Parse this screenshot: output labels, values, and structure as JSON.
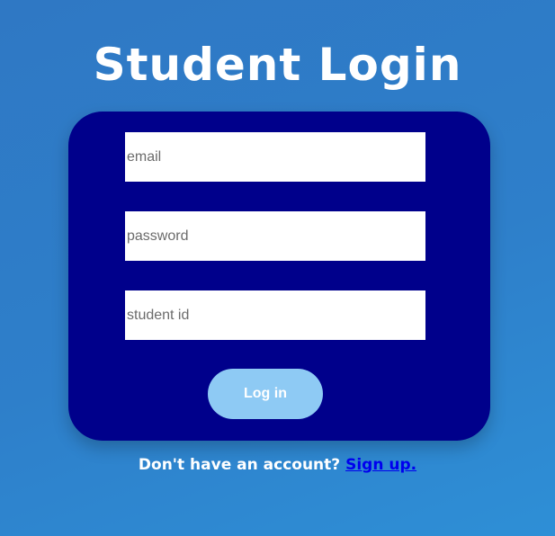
{
  "page": {
    "title": "Student Login"
  },
  "form": {
    "email_placeholder": "email",
    "email_value": "",
    "password_placeholder": "password",
    "password_value": "",
    "student_id_placeholder": "student id",
    "student_id_value": "",
    "login_label": "Log in"
  },
  "footer": {
    "prompt": "Don't have an account?",
    "signup_label": "Sign up."
  },
  "colors": {
    "background": "#2f7fca",
    "card": "#00008b",
    "button": "#8ecaf4",
    "link": "#0000ee",
    "title_text": "#ffffff"
  }
}
